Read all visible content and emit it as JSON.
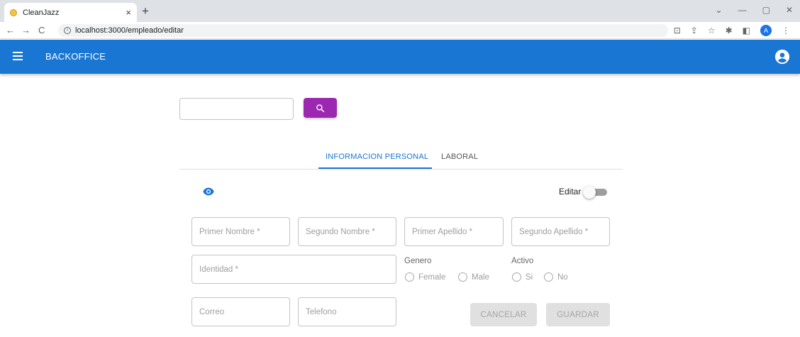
{
  "browser": {
    "tab_title": "CleanJazz",
    "tab_close": "×",
    "new_tab": "+",
    "url": "localhost:3000/empleado/editar",
    "profile_initial": "A"
  },
  "appbar": {
    "title": "BACKOFFICE"
  },
  "search": {
    "placeholder": ""
  },
  "tabs": [
    {
      "label": "INFORMACION PERSONAL",
      "active": true
    },
    {
      "label": "LABORAL",
      "active": false
    }
  ],
  "form": {
    "edit_label": "Editar",
    "edit_enabled": false,
    "fields": {
      "primer_nombre": "Primer Nombre *",
      "segundo_nombre": "Segundo Nombre *",
      "primer_apellido": "Primer Apellido *",
      "segundo_apellido": "Segundo Apellido *",
      "identidad": "Identidad *",
      "correo": "Correo",
      "telefono": "Telefono"
    },
    "genero": {
      "label": "Genero",
      "options": [
        "Female",
        "Male"
      ]
    },
    "activo": {
      "label": "Activo",
      "options": [
        "Si",
        "No"
      ]
    },
    "cancel_label": "CANCELAR",
    "save_label": "GUARDAR"
  },
  "colors": {
    "primary": "#1976d2",
    "secondary": "#9c27b0"
  },
  "icons": {
    "menu": "menu-icon",
    "account": "account-circle-icon",
    "search": "search-icon",
    "visibility": "eye-icon"
  }
}
